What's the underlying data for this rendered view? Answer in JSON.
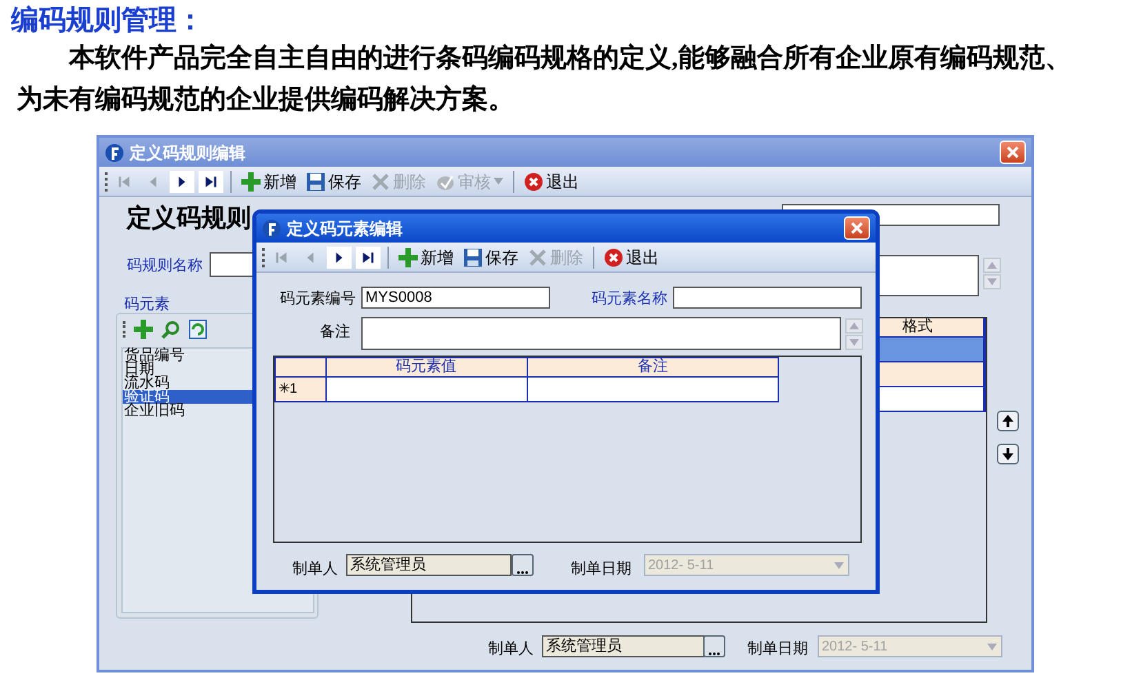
{
  "heading": "编码规则管理：",
  "paragraph": "本软件产品完全自主自由的进行条码编码规格的定义,能够融合所有企业原有编码规范、为未有编码规范的企业提供编码解决方案。",
  "main_window": {
    "title": "定义码规则编辑",
    "nav": [
      {
        "kind": "first",
        "disabled": true
      },
      {
        "kind": "prev",
        "disabled": true
      },
      {
        "kind": "next",
        "disabled": false
      },
      {
        "kind": "last",
        "disabled": false
      }
    ],
    "toolbar": [
      {
        "kind": "add",
        "label": "新增",
        "disabled": false
      },
      {
        "kind": "save",
        "label": "保存",
        "disabled": false
      },
      {
        "kind": "delete",
        "label": "删除",
        "disabled": true
      },
      {
        "kind": "audit",
        "label": "审核",
        "disabled": true
      },
      {
        "kind": "exit",
        "label": "退出",
        "disabled": false
      }
    ],
    "form_title": "定义码规则",
    "rule_name_label": "码规则名称",
    "elements_label": "码元素",
    "elements": [
      {
        "label": "货品编号",
        "selected": false
      },
      {
        "label": "日期",
        "selected": false
      },
      {
        "label": "流水码",
        "selected": false
      },
      {
        "label": "验证码",
        "selected": true
      },
      {
        "label": "企业旧码",
        "selected": false
      }
    ],
    "table": {
      "columns": [
        "格式"
      ],
      "rows": [
        {
          "selected": true
        },
        {
          "selected": false
        },
        {
          "selected": false
        }
      ]
    },
    "creator_label": "制单人",
    "creator": "系统管理员",
    "date_label": "制单日期",
    "date": "2012- 5-11"
  },
  "dialog": {
    "title": "定义码元素编辑",
    "nav": [
      {
        "kind": "first",
        "disabled": true
      },
      {
        "kind": "prev",
        "disabled": true
      },
      {
        "kind": "next",
        "disabled": false
      },
      {
        "kind": "last",
        "disabled": false
      }
    ],
    "toolbar": [
      {
        "kind": "add",
        "label": "新增",
        "disabled": false
      },
      {
        "kind": "save",
        "label": "保存",
        "disabled": false
      },
      {
        "kind": "delete",
        "label": "删除",
        "disabled": true
      },
      {
        "kind": "exit",
        "label": "退出",
        "disabled": false
      }
    ],
    "code_label": "码元素编号",
    "code": "MYS0008",
    "name_label": "码元素名称",
    "note_label": "备注",
    "grid": {
      "columns": [
        "码元素值",
        "备注"
      ],
      "rows": [
        {
          "marker": "✳1"
        }
      ]
    },
    "creator_label": "制单人",
    "creator": "系统管理员",
    "date_label": "制单日期",
    "date": "2012- 5-11"
  }
}
